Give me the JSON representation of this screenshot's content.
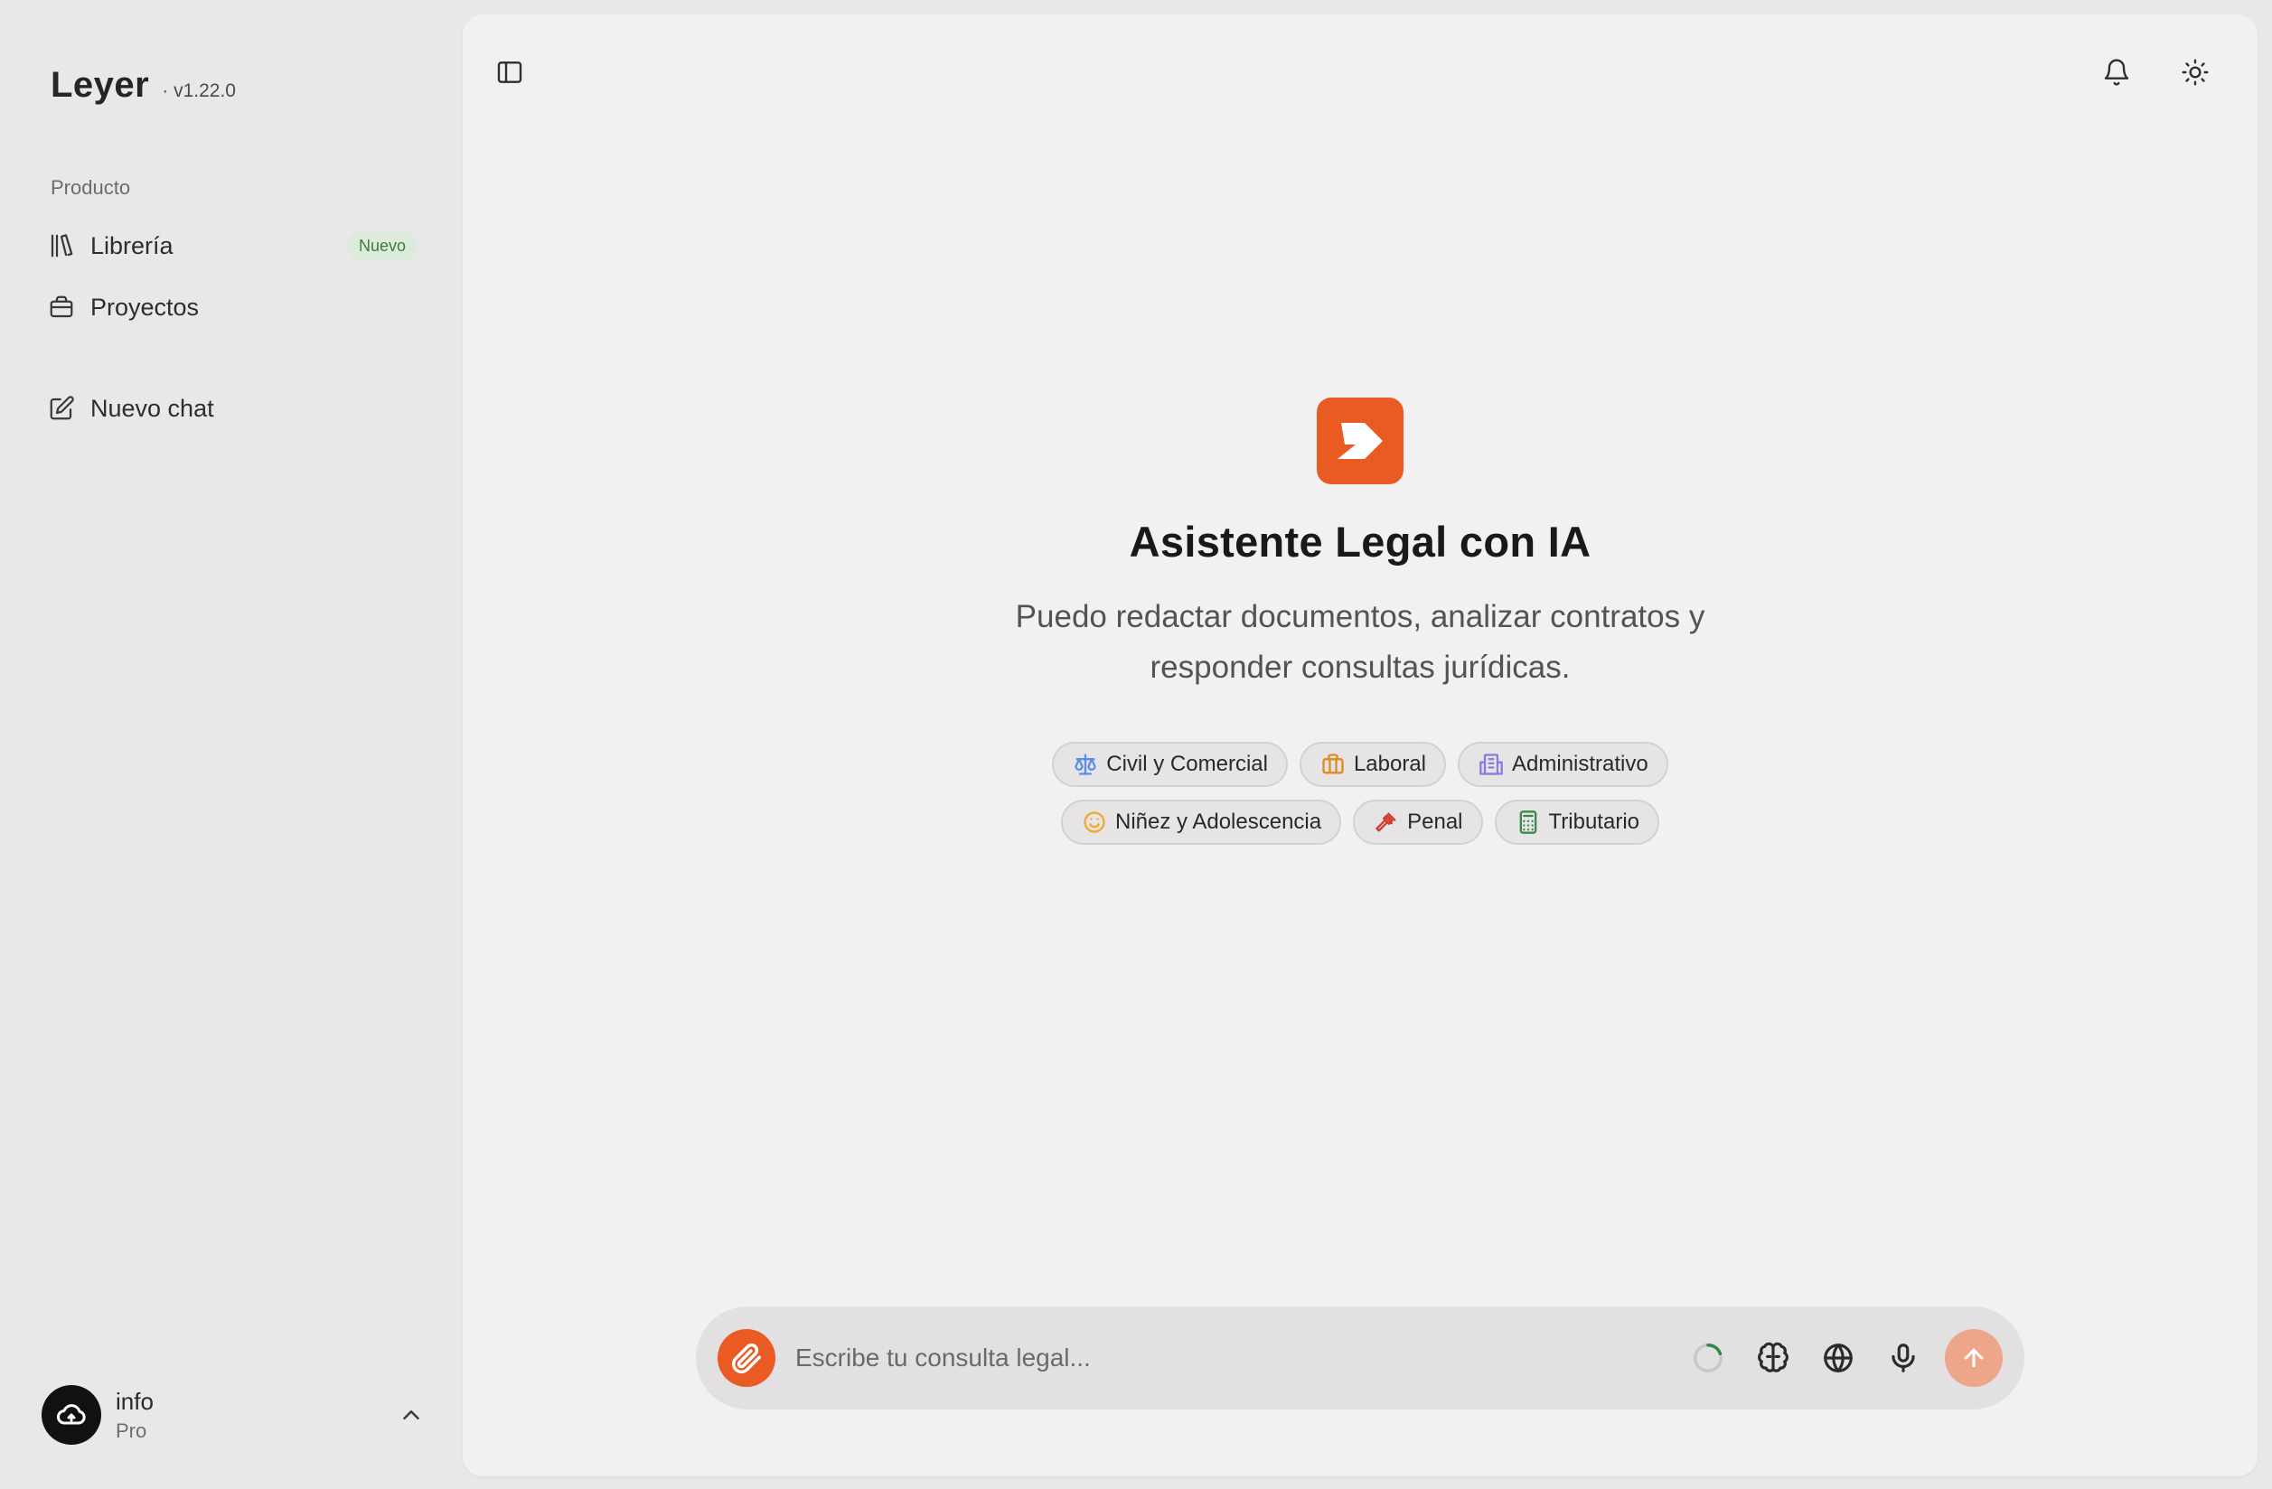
{
  "app": {
    "name": "Leyer",
    "version": "· v1.22.0"
  },
  "sidebar": {
    "section_label": "Producto",
    "items": [
      {
        "label": "Librería",
        "icon": "library-icon",
        "badge": "Nuevo"
      },
      {
        "label": "Proyectos",
        "icon": "briefcase-icon"
      }
    ],
    "new_chat": {
      "label": "Nuevo chat",
      "icon": "edit-icon"
    }
  },
  "account": {
    "name": "info",
    "plan": "Pro",
    "icon": "cloud-icon"
  },
  "header": {
    "icons": [
      "sidebar-toggle-icon",
      "bell-icon",
      "sun-icon"
    ]
  },
  "hero": {
    "title": "Asistente Legal con IA",
    "subtitle": "Puedo redactar documentos, analizar contratos y responder consultas jurídicas."
  },
  "chips": {
    "row1": [
      {
        "label": "Civil y Comercial",
        "icon": "scale-icon",
        "color": "#5b8def"
      },
      {
        "label": "Laboral",
        "icon": "briefcase-icon",
        "color": "#e38a1e"
      },
      {
        "label": "Administrativo",
        "icon": "building-icon",
        "color": "#8b7be0"
      }
    ],
    "row2": [
      {
        "label": "Niñez y Adolescencia",
        "icon": "smile-icon",
        "color": "#f0a92c"
      },
      {
        "label": "Penal",
        "icon": "gavel-icon",
        "color": "#d23b2f"
      },
      {
        "label": "Tributario",
        "icon": "calculator-icon",
        "color": "#3a8a4c"
      }
    ]
  },
  "composer": {
    "placeholder": "Escribe tu consulta legal...",
    "tools": [
      "loading-icon",
      "brain-icon",
      "globe-icon",
      "mic-icon"
    ],
    "send_icon": "arrow-up-icon"
  },
  "colors": {
    "accent": "#ea5a23",
    "send_disabled": "#eea68a",
    "badge_bg": "#dcebdc",
    "badge_text": "#3c7a45"
  }
}
